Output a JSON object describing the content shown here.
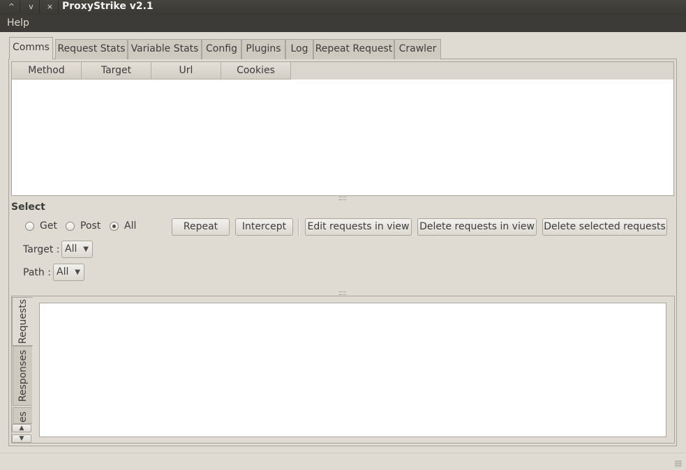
{
  "window": {
    "title": "ProxyStrike v2.1",
    "controls": [
      "^",
      "v",
      "×"
    ]
  },
  "menubar": {
    "items": [
      "Help"
    ]
  },
  "tabs": [
    "Comms",
    "Request Stats",
    "Variable Stats",
    "Config",
    "Plugins",
    "Log",
    "Repeat Request",
    "Crawler"
  ],
  "active_tab": "Comms",
  "table": {
    "columns": [
      "Method",
      "Target",
      "Url",
      "Cookies"
    ],
    "rows": []
  },
  "select": {
    "heading": "Select",
    "methods": [
      {
        "label": "Get",
        "checked": false
      },
      {
        "label": "Post",
        "checked": false
      },
      {
        "label": "All",
        "checked": true
      }
    ],
    "target_label": "Target :",
    "target_value": "All",
    "path_label": "Path :",
    "path_value": "All"
  },
  "buttons": {
    "repeat": "Repeat",
    "intercept": "Intercept",
    "edit": "Edit requests in view",
    "delete_view": "Delete requests in view",
    "delete_selected": "Delete selected requests"
  },
  "bottom_tabs": [
    "Requests",
    "Responses",
    "es"
  ],
  "active_bottom_tab": "Requests",
  "request_text": ""
}
